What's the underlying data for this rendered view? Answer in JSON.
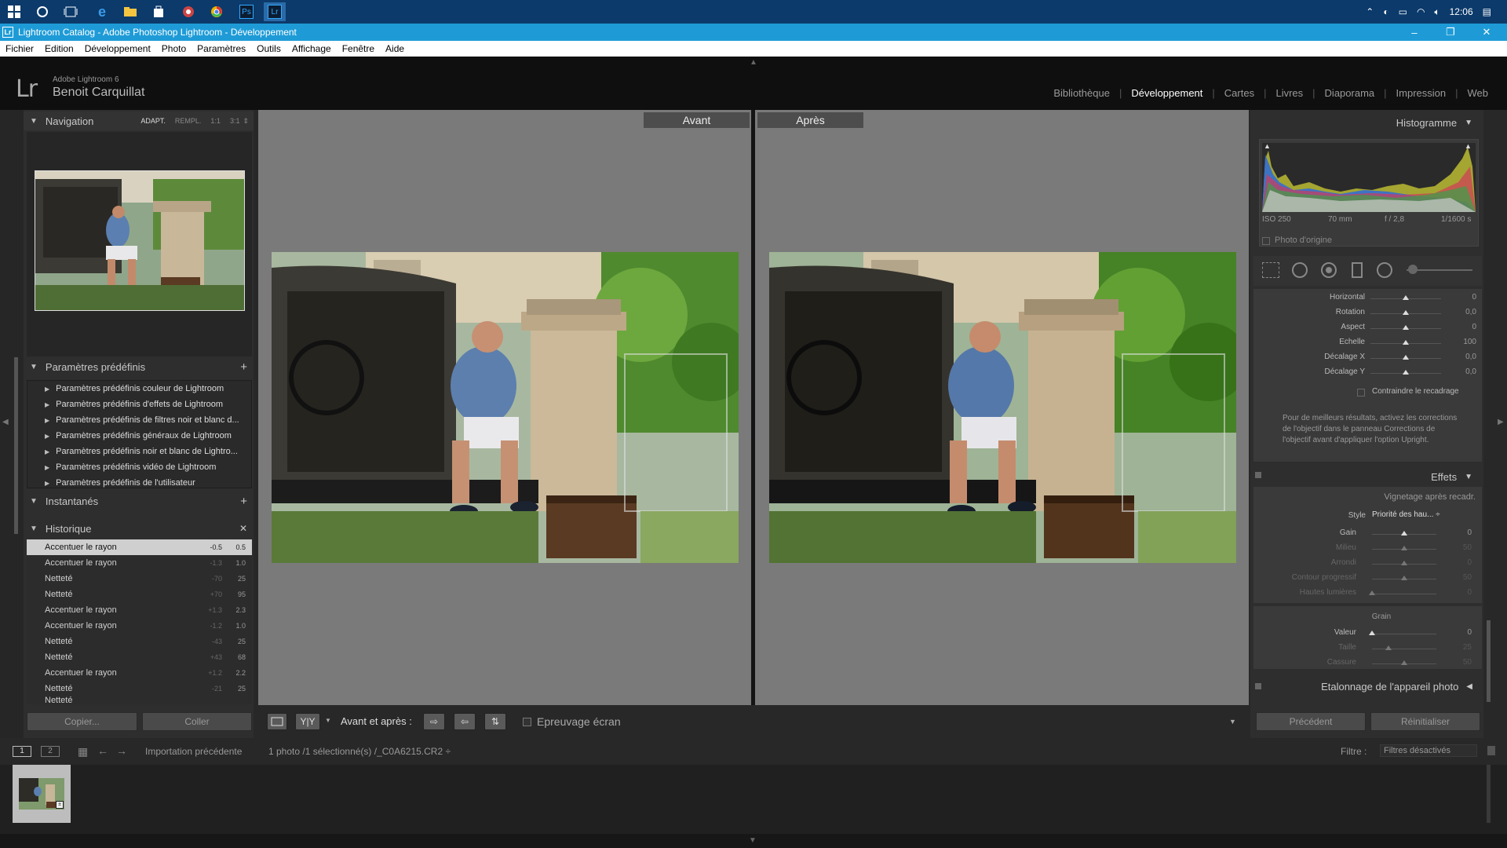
{
  "taskbar": {
    "time": "12:06",
    "apps": [
      "start-icon",
      "cortana-icon",
      "task-view-icon",
      "edge-icon",
      "explorer-icon",
      "store-icon",
      "app-icon",
      "chrome-icon",
      "photoshop-icon",
      "lightroom-icon"
    ],
    "ps_label": "Ps",
    "lr_label": "Lr"
  },
  "window": {
    "title": "Lightroom Catalog - Adobe Photoshop Lightroom - Développement",
    "icon_label": "Lr",
    "minimize": "–",
    "maximize": "❐",
    "close": "✕"
  },
  "menu": [
    "Fichier",
    "Edition",
    "Développement",
    "Photo",
    "Paramètres",
    "Outils",
    "Affichage",
    "Fenêtre",
    "Aide"
  ],
  "identity": {
    "logo": "Lr",
    "app_name": "Adobe Lightroom 6",
    "user": "Benoit Carquillat"
  },
  "modules": [
    "Bibliothèque",
    "Développement",
    "Cartes",
    "Livres",
    "Diaporama",
    "Impression",
    "Web"
  ],
  "active_module": "Développement",
  "navigator": {
    "title": "Navigation",
    "zoom_options": [
      "ADAPT.",
      "REMPL.",
      "1:1",
      "3:1"
    ]
  },
  "presets": {
    "title": "Paramètres prédéfinis",
    "add": "+",
    "items": [
      "Paramètres prédéfinis couleur de Lightroom",
      "Paramètres prédéfinis d'effets de Lightroom",
      "Paramètres prédéfinis de filtres noir et blanc d...",
      "Paramètres prédéfinis généraux de Lightroom",
      "Paramètres prédéfinis noir et blanc de Lightro...",
      "Paramètres prédéfinis vidéo de Lightroom",
      "Paramètres prédéfinis de l'utilisateur"
    ]
  },
  "snapshots": {
    "title": "Instantanés",
    "add": "+"
  },
  "history": {
    "title": "Historique",
    "clear": "✕",
    "items": [
      {
        "name": "Accentuer le rayon",
        "a": "-0.5",
        "b": "0.5"
      },
      {
        "name": "Accentuer le rayon",
        "a": "-1.3",
        "b": "1.0"
      },
      {
        "name": "Netteté",
        "a": "-70",
        "b": "25"
      },
      {
        "name": "Netteté",
        "a": "+70",
        "b": "95"
      },
      {
        "name": "Accentuer le rayon",
        "a": "+1.3",
        "b": "2.3"
      },
      {
        "name": "Accentuer le rayon",
        "a": "-1.2",
        "b": "1.0"
      },
      {
        "name": "Netteté",
        "a": "-43",
        "b": "25"
      },
      {
        "name": "Netteté",
        "a": "+43",
        "b": "68"
      },
      {
        "name": "Accentuer le rayon",
        "a": "+1.2",
        "b": "2.2"
      },
      {
        "name": "Netteté",
        "a": "-21",
        "b": "25"
      },
      {
        "name": "Netteté",
        "a": "",
        "b": ""
      }
    ]
  },
  "left_buttons": {
    "copy": "Copier...",
    "paste": "Coller"
  },
  "compare": {
    "before": "Avant",
    "after": "Après"
  },
  "toolbar": {
    "view_mode": "Y|Y",
    "before_after_label": "Avant et après :",
    "soft_proof": "Epreuvage écran"
  },
  "histogram": {
    "title": "Histogramme",
    "exif": [
      "ISO 250",
      "70 mm",
      "f / 2,8",
      "1/1600 s"
    ],
    "original_photo": "Photo d'origine"
  },
  "transform": {
    "params": [
      {
        "label": "Horizontal",
        "value": "0",
        "pos": 0.5
      },
      {
        "label": "Rotation",
        "value": "0,0",
        "pos": 0.5
      },
      {
        "label": "Aspect",
        "value": "0",
        "pos": 0.5
      },
      {
        "label": "Echelle",
        "value": "100",
        "pos": 0.5
      },
      {
        "label": "Décalage X",
        "value": "0,0",
        "pos": 0.5
      },
      {
        "label": "Décalage Y",
        "value": "0,0",
        "pos": 0.5
      }
    ],
    "constrain_crop": "Contraindre le recadrage",
    "upright_note": "Pour de meilleurs résultats, activez les corrections de l'objectif dans le panneau Corrections de l'objectif avant d'appliquer l'option Upright."
  },
  "effects": {
    "title": "Effets",
    "vignette_title": "Vignetage après recadr.",
    "style_label": "Style",
    "style_value": "Priorité des hau... ÷",
    "vignette_params": [
      {
        "label": "Gain",
        "value": "0",
        "pos": 0.5,
        "dim": false
      },
      {
        "label": "Milieu",
        "value": "50",
        "pos": 0.5,
        "dim": true
      },
      {
        "label": "Arrondi",
        "value": "0",
        "pos": 0.5,
        "dim": true
      },
      {
        "label": "Contour progressif",
        "value": "50",
        "pos": 0.5,
        "dim": true
      },
      {
        "label": "Hautes lumières",
        "value": "0",
        "pos": 0.0,
        "dim": true
      }
    ],
    "grain_title": "Grain",
    "grain_params": [
      {
        "label": "Valeur",
        "value": "0",
        "pos": 0.0,
        "dim": false
      },
      {
        "label": "Taille",
        "value": "25",
        "pos": 0.25,
        "dim": true
      },
      {
        "label": "Cassure",
        "value": "50",
        "pos": 0.5,
        "dim": true
      }
    ]
  },
  "camera_calibration": {
    "title": "Etalonnage de l'appareil photo"
  },
  "right_buttons": {
    "previous": "Précédent",
    "reset": "Réinitialiser"
  },
  "filmstrip": {
    "screen1": "1",
    "screen2": "2",
    "source": "Importation précédente",
    "info": "1 photo /1 sélectionné(s) /_C0A6215.CR2 ÷",
    "filter_label": "Filtre :",
    "filter_value": "Filtres désactivés"
  }
}
